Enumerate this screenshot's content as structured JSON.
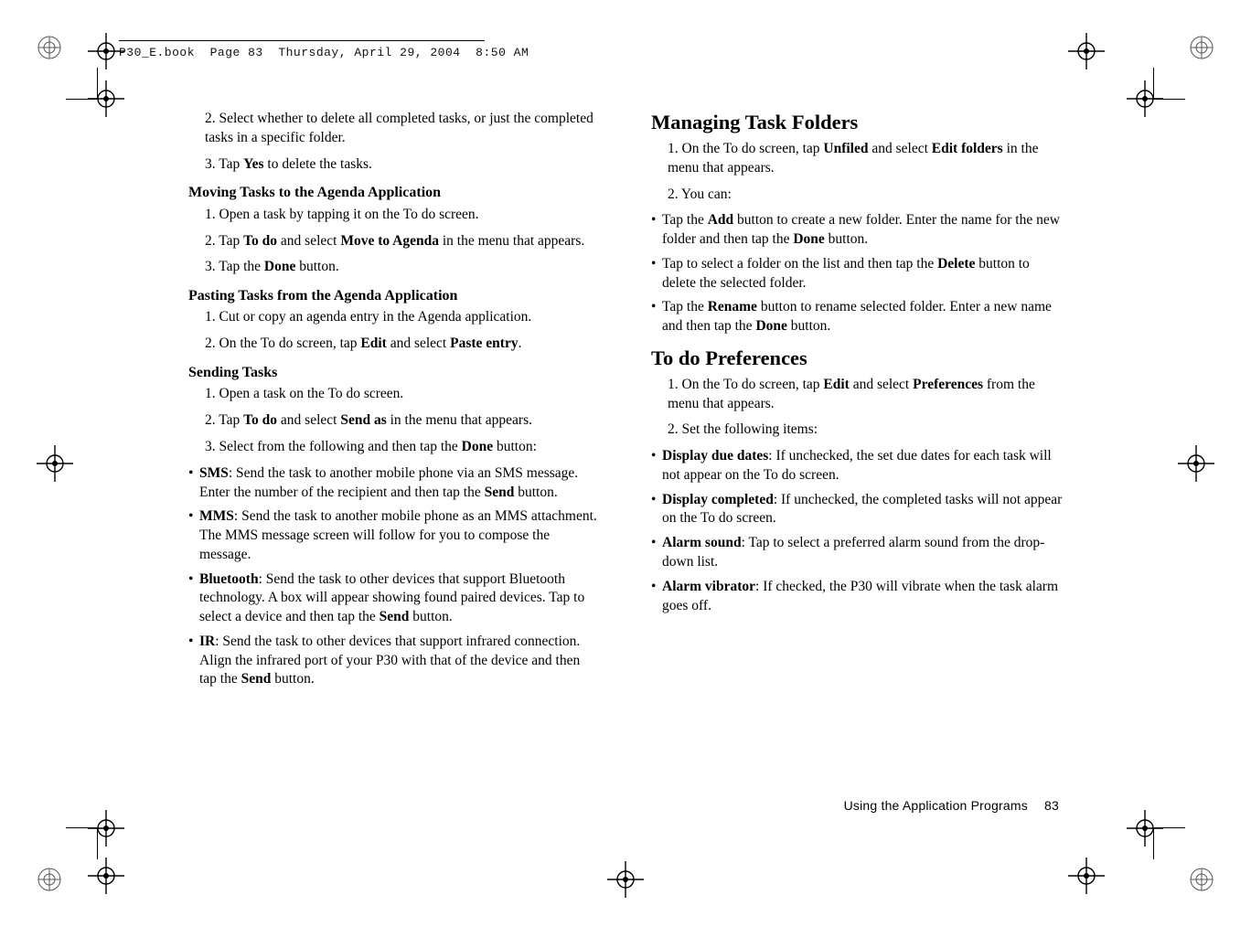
{
  "running_header": "P30_E.book  Page 83  Thursday, April 29, 2004  8:50 AM",
  "left": {
    "step2": "2. Select whether to delete all completed tasks, or just the completed tasks in a specific folder.",
    "step3_pre": "3. Tap ",
    "step3_b": "Yes",
    "step3_post": " to delete the tasks.",
    "move_h3": "Moving Tasks to the Agenda Application",
    "move_1": "1. Open a task by tapping it on the To do screen.",
    "move_2_a": "2. Tap ",
    "move_2_b": "To do",
    "move_2_c": " and select ",
    "move_2_d": "Move to Agenda",
    "move_2_e": " in the menu that appears.",
    "move_3_a": "3. Tap the ",
    "move_3_b": "Done",
    "move_3_c": " button.",
    "paste_h3": "Pasting Tasks from the Agenda Application",
    "paste_1": "1. Cut or copy an agenda entry in the Agenda application.",
    "paste_2_a": "2. On the To do screen, tap ",
    "paste_2_b": "Edit",
    "paste_2_c": " and select ",
    "paste_2_d": "Paste entry",
    "paste_2_e": ".",
    "send_h3": "Sending Tasks",
    "send_1": "1. Open a task on the To do screen.",
    "send_2_a": "2. Tap ",
    "send_2_b": "To do",
    "send_2_c": " and select ",
    "send_2_d": "Send as",
    "send_2_e": " in the menu that appears.",
    "send_3_a": "3. Select from the following and then tap the ",
    "send_3_b": "Done",
    "send_3_c": " button:",
    "sms_b": "SMS",
    "sms_t": ": Send the task to another mobile phone via an SMS message. Enter the number of the recipient and then tap the ",
    "sms_b2": "Send",
    "sms_t2": " button.",
    "mms_b": "MMS",
    "mms_t": ": Send the task to another mobile phone as an MMS attachment. The MMS message screen will follow for you to compose the message.",
    "bt_b": "Bluetooth",
    "bt_t": ": Send the task to other devices that support Bluetooth technology. A box will appear showing found paired devices. Tap to select a device and then tap the ",
    "bt_b2": "Send",
    "bt_t2": " button.",
    "ir_b": "IR",
    "ir_t": ": Send the task to other devices that support infrared connection. Align the infrared port of your P30 with that of the device and then tap the ",
    "ir_b2": "Send",
    "ir_t2": " button."
  },
  "right": {
    "folders_h2": "Managing Task Folders",
    "folders_1_a": "1. On the To do screen, tap ",
    "folders_1_b": "Unfiled",
    "folders_1_c": " and select ",
    "folders_1_d": "Edit folders",
    "folders_1_e": " in the menu that appears.",
    "folders_2": "2. You can:",
    "add_a": "Tap the ",
    "add_b": "Add",
    "add_c": " button to create a new folder. Enter the name for the new folder and then tap the ",
    "add_d": "Done",
    "add_e": " button.",
    "del_a": " Tap to select a folder on the list and then tap the ",
    "del_b": "Delete",
    "del_c": " button to delete the selected folder.",
    "ren_a": "Tap the ",
    "ren_b": "Rename",
    "ren_c": " button to rename selected folder. Enter a new name and then tap the ",
    "ren_d": "Done",
    "ren_e": " button.",
    "prefs_h2": "To do Preferences",
    "prefs_1_a": "1. On the To do screen, tap ",
    "prefs_1_b": "Edit",
    "prefs_1_c": " and select ",
    "prefs_1_d": "Preferences",
    "prefs_1_e": " from the menu that appears.",
    "prefs_2": "2. Set the following items:",
    "dd_b": "Display due dates",
    "dd_t": ": If unchecked, the set due dates for each task will not appear on the To do screen.",
    "dc_b": "Display completed",
    "dc_t": ": If unchecked, the completed tasks will not appear on the To do screen.",
    "as_b": "Alarm sound",
    "as_t": ": Tap to select a preferred alarm sound from the drop-down list.",
    "av_b": "Alarm vibrator",
    "av_t": ": If checked, the P30 will vibrate when the task alarm goes off."
  },
  "footer": {
    "section": "Using the Application Programs",
    "page": "83"
  }
}
